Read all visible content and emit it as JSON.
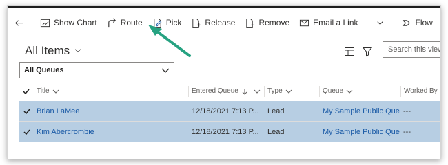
{
  "commandbar": {
    "show_chart": "Show Chart",
    "route": "Route",
    "pick": "Pick",
    "release": "Release",
    "remove": "Remove",
    "email_link": "Email a Link",
    "flow": "Flow"
  },
  "view": {
    "title": "All Items",
    "search_placeholder": "Search this view"
  },
  "queue_filter": {
    "selected": "All Queues"
  },
  "grid": {
    "columns": {
      "title": "Title",
      "entered_queue": "Entered Queue",
      "type": "Type",
      "queue": "Queue",
      "worked_by": "Worked By"
    },
    "rows": [
      {
        "title": "Brian LaMee",
        "entered_queue": "12/18/2021 7:13 P...",
        "type": "Lead",
        "queue": "My Sample Public Queue",
        "worked_by": "---"
      },
      {
        "title": "Kim Abercrombie",
        "entered_queue": "12/18/2021 7:13 P...",
        "type": "Lead",
        "queue": "My Sample Public Queue",
        "worked_by": "---"
      }
    ]
  },
  "colors": {
    "selected_row": "#b7cee3",
    "link": "#1a5aa6",
    "arrow": "#26a281"
  }
}
